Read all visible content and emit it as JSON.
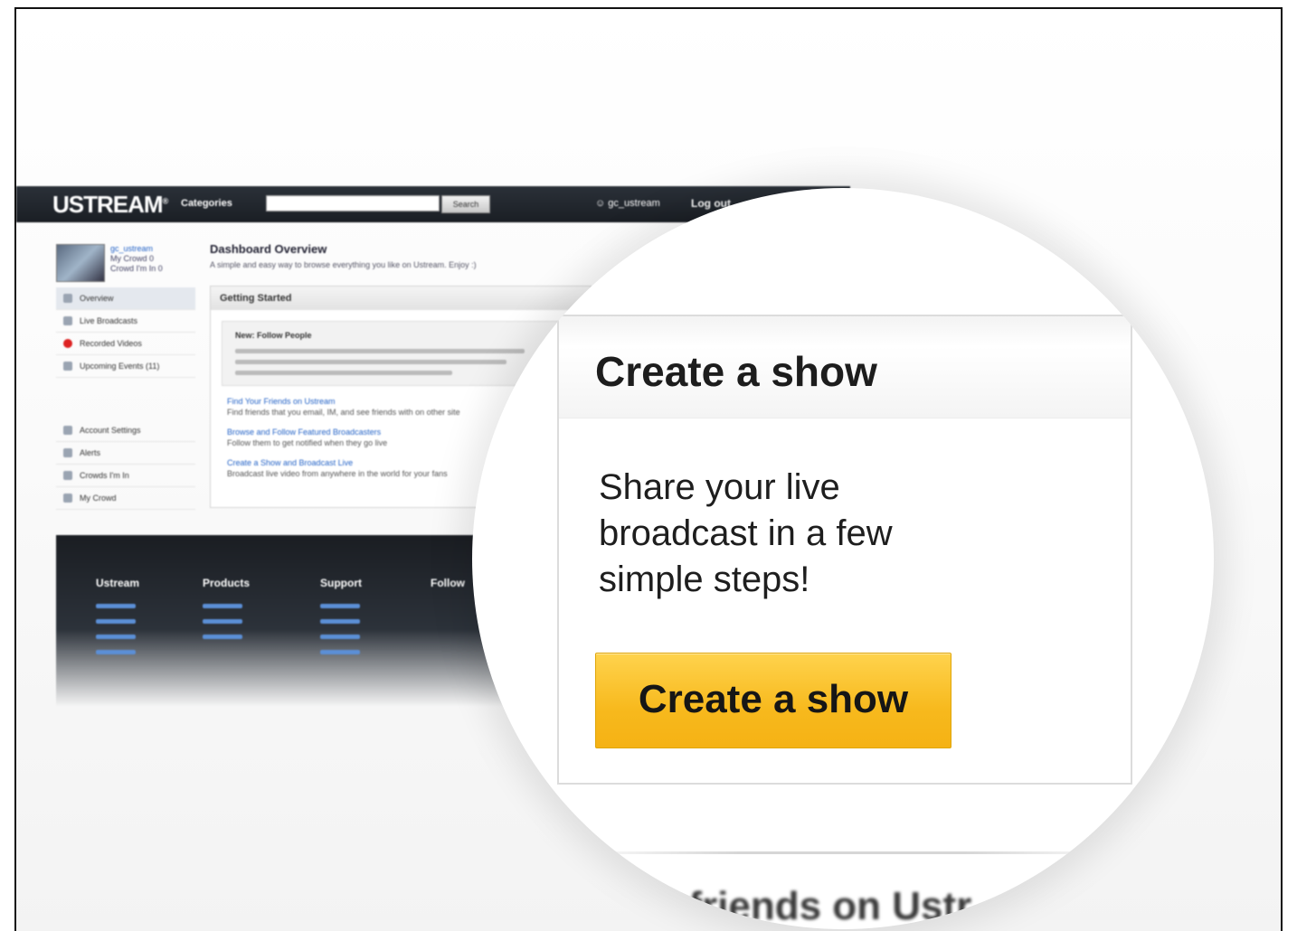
{
  "background_site": {
    "logo": "USTREAM",
    "nav_categories": "Categories",
    "search_button": "Search",
    "username_top": "gc_ustream",
    "logout": "Log out",
    "profile": {
      "username": "gc_ustream",
      "line2": "My Crowd 0",
      "line3": "Crowd I'm In 0"
    },
    "side_menu": [
      {
        "label": "Overview",
        "active": true
      },
      {
        "label": "Live Broadcasts"
      },
      {
        "label": "Recorded Videos"
      },
      {
        "label": "Upcoming Events (11)"
      }
    ],
    "side_menu_2": [
      {
        "label": "Account Settings"
      },
      {
        "label": "Alerts"
      },
      {
        "label": "Crowds I'm In"
      },
      {
        "label": "My Crowd"
      }
    ],
    "dashboard_title": "Dashboard Overview",
    "dashboard_subtitle": "A simple and easy way to browse everything you like on Ustream. Enjoy :)",
    "getting_started": "Getting Started",
    "follow_box_title": "New: Follow People",
    "links": [
      {
        "title": "Find Your Friends on Ustream",
        "desc": "Find friends that you email, IM, and see friends with on other site"
      },
      {
        "title": "Browse and Follow Featured Broadcasters",
        "desc": "Follow them to get notified when they go live"
      },
      {
        "title": "Create a Show and Broadcast Live",
        "desc": "Broadcast live video from anywhere in the world for your fans"
      }
    ],
    "footer_columns": [
      "Ustream",
      "Products",
      "Support",
      "Follow"
    ]
  },
  "magnified": {
    "panel_title": "Create a show",
    "panel_description": "Share your live broadcast in a few simple steps!",
    "button_label": "Create a show",
    "next_section_fragment": "r friends on Ustr"
  }
}
